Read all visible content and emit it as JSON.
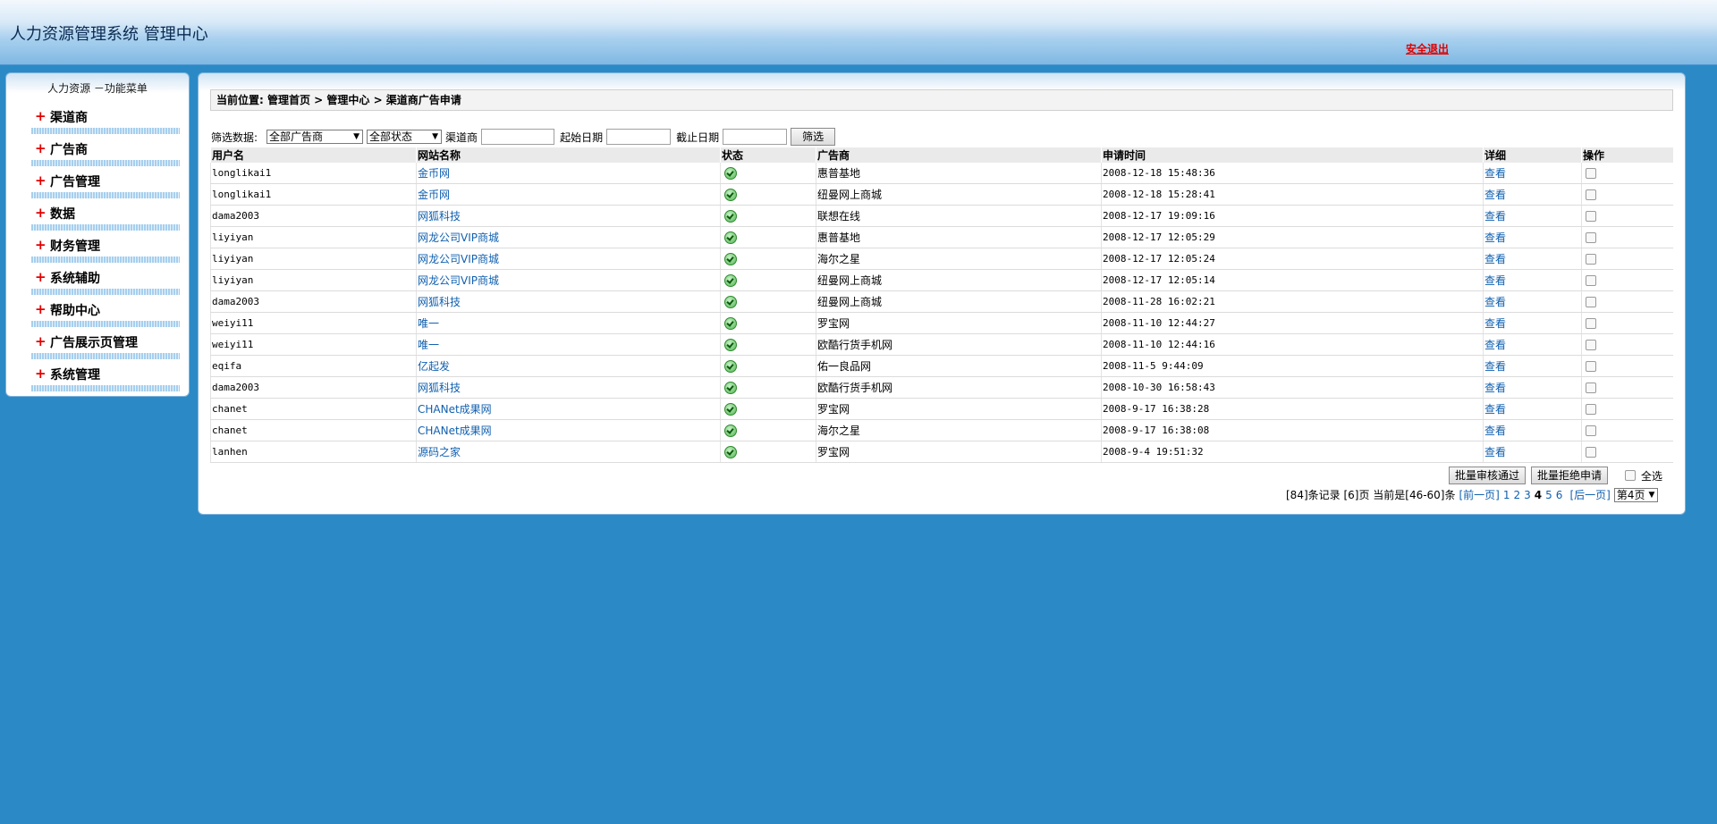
{
  "header": {
    "title": "人力资源管理系统 管理中心",
    "logout": "安全退出"
  },
  "sidebar": {
    "title": "人力资源 －功能菜单",
    "items": [
      {
        "label": "渠道商"
      },
      {
        "label": "广告商"
      },
      {
        "label": "广告管理"
      },
      {
        "label": "数据"
      },
      {
        "label": "财务管理"
      },
      {
        "label": "系统辅助"
      },
      {
        "label": "帮助中心"
      },
      {
        "label": "广告展示页管理"
      },
      {
        "label": "系统管理"
      }
    ]
  },
  "breadcrumb": "当前位置: 管理首页 > 管理中心 > 渠道商广告申请",
  "filter": {
    "label": "筛选数据:",
    "advertiser_select": "全部广告商",
    "status_select": "全部状态",
    "channel_label": "渠道商",
    "start_label": "起始日期",
    "end_label": "截止日期",
    "submit": "筛选"
  },
  "table": {
    "headers": [
      "用户名",
      "网站名称",
      "状态",
      "广告商",
      "申请时间",
      "详细",
      "操作"
    ],
    "rows": [
      {
        "user": "longlikai1",
        "site": "金币网",
        "advertiser": "惠普基地",
        "time": "2008-12-18 15:48:36",
        "detail": "查看"
      },
      {
        "user": "longlikai1",
        "site": "金币网",
        "advertiser": "纽曼网上商城",
        "time": "2008-12-18 15:28:41",
        "detail": "查看"
      },
      {
        "user": "dama2003",
        "site": "网狐科技",
        "advertiser": "联想在线",
        "time": "2008-12-17 19:09:16",
        "detail": "查看"
      },
      {
        "user": "liyiyan",
        "site": "网龙公司VIP商城",
        "advertiser": "惠普基地",
        "time": "2008-12-17 12:05:29",
        "detail": "查看"
      },
      {
        "user": "liyiyan",
        "site": "网龙公司VIP商城",
        "advertiser": "海尔之星",
        "time": "2008-12-17 12:05:24",
        "detail": "查看"
      },
      {
        "user": "liyiyan",
        "site": "网龙公司VIP商城",
        "advertiser": "纽曼网上商城",
        "time": "2008-12-17 12:05:14",
        "detail": "查看"
      },
      {
        "user": "dama2003",
        "site": "网狐科技",
        "advertiser": "纽曼网上商城",
        "time": "2008-11-28 16:02:21",
        "detail": "查看"
      },
      {
        "user": "weiyi11",
        "site": "唯一",
        "advertiser": "罗宝网",
        "time": "2008-11-10 12:44:27",
        "detail": "查看"
      },
      {
        "user": "weiyi11",
        "site": "唯一",
        "advertiser": "欧酷行货手机网",
        "time": "2008-11-10 12:44:16",
        "detail": "查看"
      },
      {
        "user": "eqifa",
        "site": "亿起发",
        "advertiser": "佑一良品网",
        "time": "2008-11-5 9:44:09",
        "detail": "查看"
      },
      {
        "user": "dama2003",
        "site": "网狐科技",
        "advertiser": "欧酷行货手机网",
        "time": "2008-10-30 16:58:43",
        "detail": "查看"
      },
      {
        "user": "chanet",
        "site": "CHANet成果网",
        "advertiser": "罗宝网",
        "time": "2008-9-17 16:38:28",
        "detail": "查看"
      },
      {
        "user": "chanet",
        "site": "CHANet成果网",
        "advertiser": "海尔之星",
        "time": "2008-9-17 16:38:08",
        "detail": "查看"
      },
      {
        "user": "lanhen",
        "site": "源码之家",
        "advertiser": "罗宝网",
        "time": "2008-9-4 19:51:32",
        "detail": "查看"
      }
    ]
  },
  "actions": {
    "approve": "批量审核通过",
    "reject": "批量拒绝申请",
    "select_all": "全选"
  },
  "pager": {
    "summary": "[84]条记录 [6]页 当前是[46-60]条",
    "prev": "[前一页]",
    "pages": [
      "1",
      "2",
      "3",
      "4",
      "5",
      "6"
    ],
    "current": "4",
    "next": "[后一页]",
    "jump": "第4页"
  },
  "colors": {
    "background": "#2b8ac6",
    "link": "#1060b0",
    "logout": "#e00000",
    "plus": "#e30000"
  }
}
